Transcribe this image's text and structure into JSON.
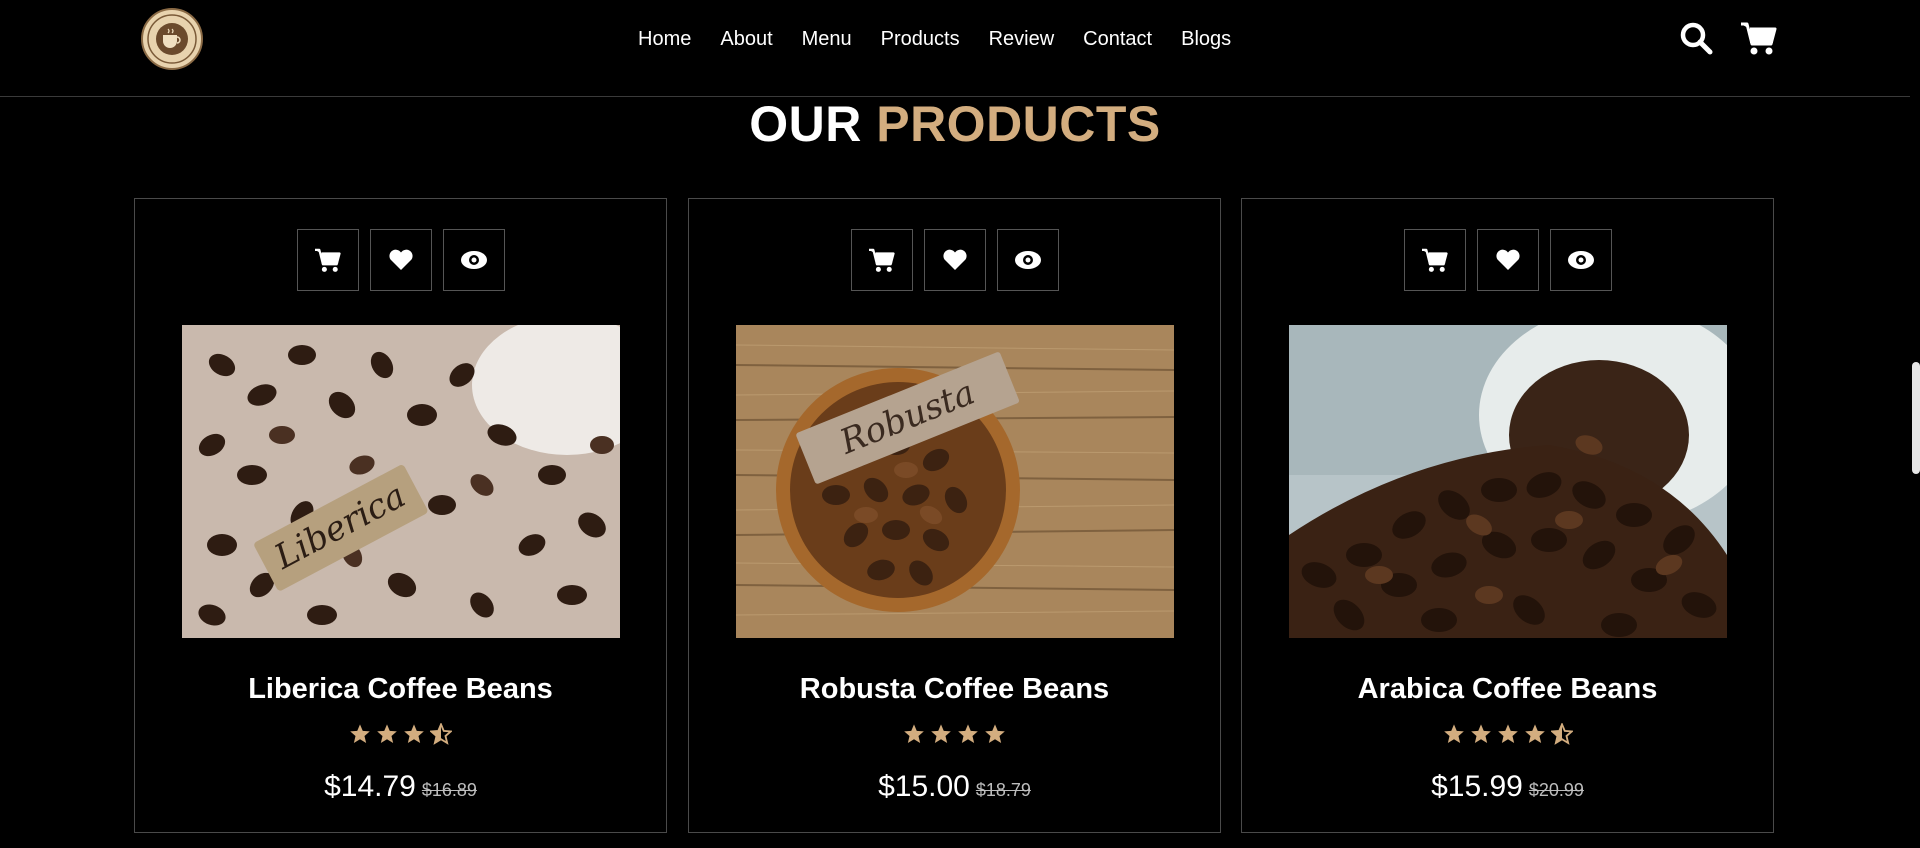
{
  "nav": {
    "items": [
      "Home",
      "About",
      "Menu",
      "Products",
      "Review",
      "Contact",
      "Blogs"
    ]
  },
  "header_icons": [
    "search-icon",
    "cart-icon"
  ],
  "section_title": {
    "part1": "OUR",
    "part2": "PRODUCTS"
  },
  "colors": {
    "accent": "#d3ad7f",
    "background": "#000000"
  },
  "products": [
    {
      "name": "Liberica Coffee Beans",
      "rating": 3.5,
      "price": "$14.79",
      "old_price": "$16.89",
      "image": "liberica-beans-image",
      "tag": "Liberica"
    },
    {
      "name": "Robusta Coffee Beans",
      "rating": 4,
      "price": "$15.00",
      "old_price": "$18.79",
      "image": "robusta-beans-image",
      "tag": "Robusta"
    },
    {
      "name": "Arabica Coffee Beans",
      "rating": 4.5,
      "price": "$15.99",
      "old_price": "$20.99",
      "image": "arabica-beans-image"
    }
  ],
  "card_actions": [
    "cart-icon",
    "heart-icon",
    "eye-icon"
  ]
}
